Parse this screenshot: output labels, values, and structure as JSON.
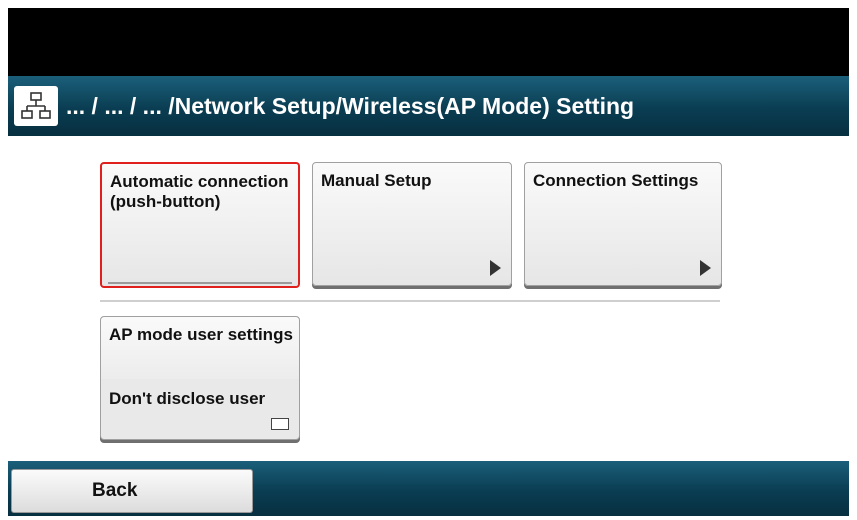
{
  "header": {
    "title": "... / ... / ... /Network Setup/Wireless(AP Mode) Setting",
    "icon": "network-icon"
  },
  "tiles": [
    {
      "label": "Automatic connection (push-button)",
      "selected": true,
      "indicator": "none"
    },
    {
      "label": "Manual Setup",
      "selected": false,
      "indicator": "arrow-right-icon"
    },
    {
      "label": "Connection Settings",
      "selected": false,
      "indicator": "arrow-right-icon"
    }
  ],
  "ap_mode_tile": {
    "label": "AP mode user settings",
    "value": "Don't disclose user",
    "indicator": "dropdown-box-icon"
  },
  "footer": {
    "back_label": "Back"
  },
  "colors": {
    "bar": "#0a3d52",
    "selection": "#e0201c"
  }
}
